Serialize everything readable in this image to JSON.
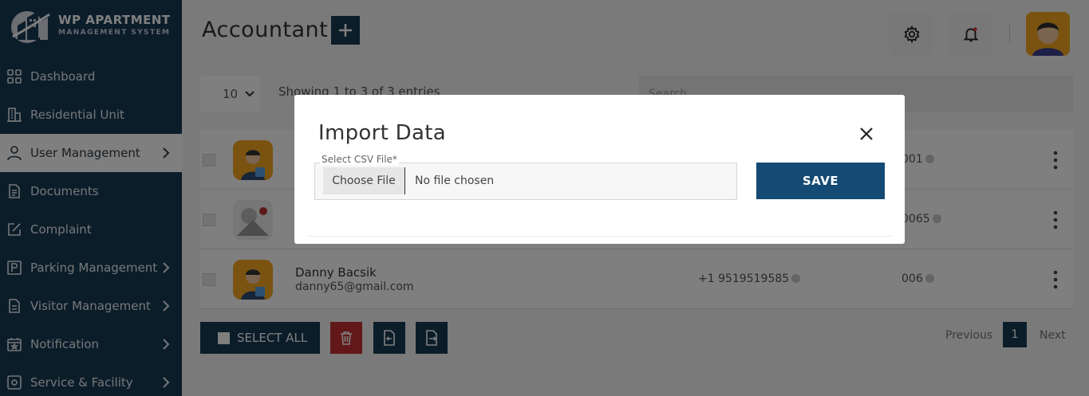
{
  "sidebar": {
    "logo_title": "WP APARTMENT",
    "logo_subtitle": "MANAGEMENT SYSTEM",
    "items": [
      {
        "label": "Dashboard",
        "icon": "grid-icon"
      },
      {
        "label": "Residential Unit",
        "icon": "building-icon"
      },
      {
        "label": "User Management",
        "icon": "user-icon",
        "active": true
      },
      {
        "label": "Documents",
        "icon": "document-icon"
      },
      {
        "label": "Complaint",
        "icon": "edit-icon"
      },
      {
        "label": "Parking Management",
        "icon": "parking-icon"
      },
      {
        "label": "Visitor Management",
        "icon": "clipboard-icon"
      },
      {
        "label": "Notification",
        "icon": "calendar-icon"
      },
      {
        "label": "Service & Facility",
        "icon": "service-icon"
      }
    ]
  },
  "header": {
    "title": "Accountant",
    "add_icon": "plus-icon",
    "settings_icon": "gear-icon",
    "notification_icon": "bell-icon"
  },
  "listing": {
    "page_size": "10",
    "showing": "Showing 1 to 3 of 3 entries",
    "search_placeholder": "Search...",
    "rows": [
      {
        "name": "",
        "email": "",
        "phone": "",
        "unit": "001"
      },
      {
        "name": "",
        "email": "",
        "phone": "",
        "unit": "0065"
      },
      {
        "name": "Danny Bacsik",
        "email": "danny65@gmail.com",
        "phone": "+1 9519519585",
        "unit": "006"
      }
    ],
    "select_all": "SELECT ALL",
    "pagination": {
      "previous": "Previous",
      "current": "1",
      "next": "Next"
    }
  },
  "modal": {
    "title": "Import Data",
    "file_label": "Select CSV File*",
    "choose_button": "Choose File",
    "no_file": "No file chosen",
    "save_button": "SAVE"
  },
  "colors": {
    "primary": "#183b54",
    "save": "#144a74",
    "danger": "#c53030",
    "avatar": "#f5a623"
  }
}
